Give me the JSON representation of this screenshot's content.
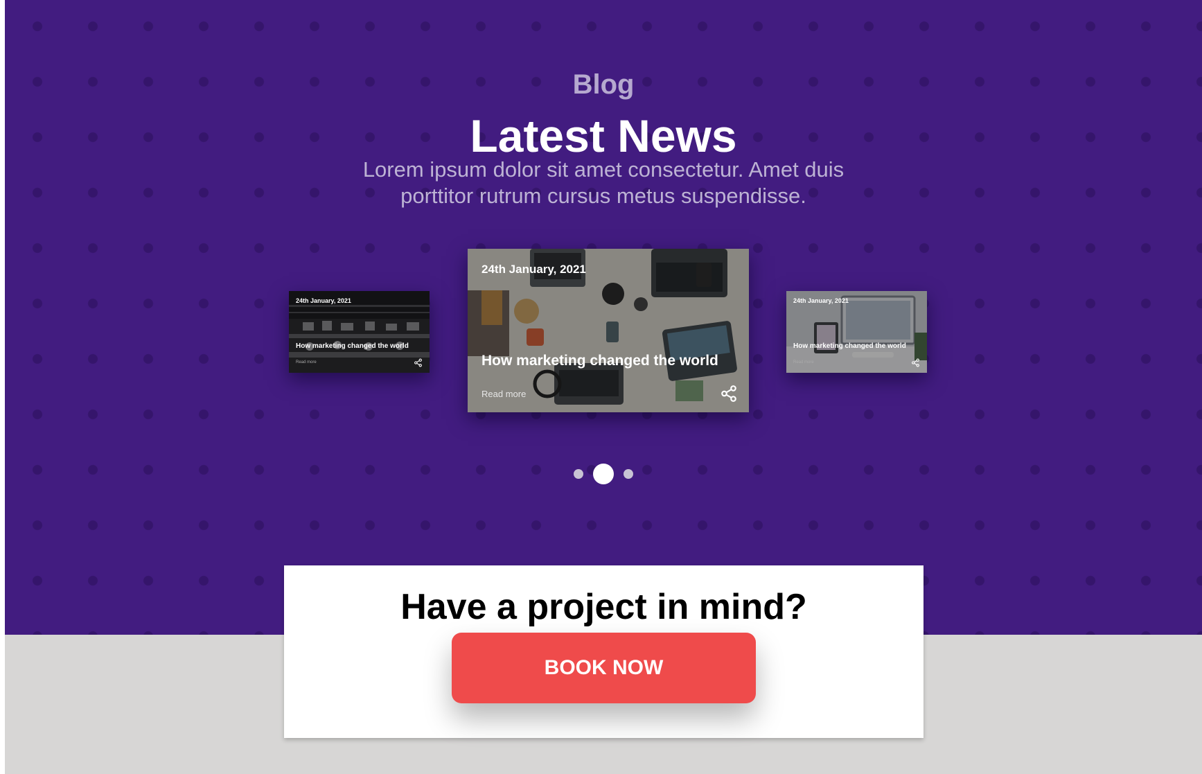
{
  "blog": {
    "eyebrow": "Blog",
    "headline": "Latest News",
    "subtitle": "Lorem ipsum dolor sit amet consectetur. Amet duis porttitor rutrum cursus metus suspendisse."
  },
  "carousel": {
    "cards": [
      {
        "position": "left",
        "date": "24th January, 2021",
        "title": "How marketing changed the world",
        "read_more": "Read more",
        "icon": "share-icon"
      },
      {
        "position": "center",
        "date": "24th January, 2021",
        "title": "How marketing changed the world",
        "read_more": "Read more",
        "icon": "share-icon"
      },
      {
        "position": "right",
        "date": "24th January, 2021",
        "title": "How marketing changed the world",
        "read_more": "Read more",
        "icon": "share-icon"
      }
    ],
    "active_index": 1
  },
  "cta": {
    "title": "Have a project in mind?",
    "button_label": "BOOK NOW"
  },
  "colors": {
    "hero_background": "#421c80",
    "hero_dots": "#35156b",
    "button": "#ef4b4b",
    "page_background": "#d7d6d5"
  }
}
